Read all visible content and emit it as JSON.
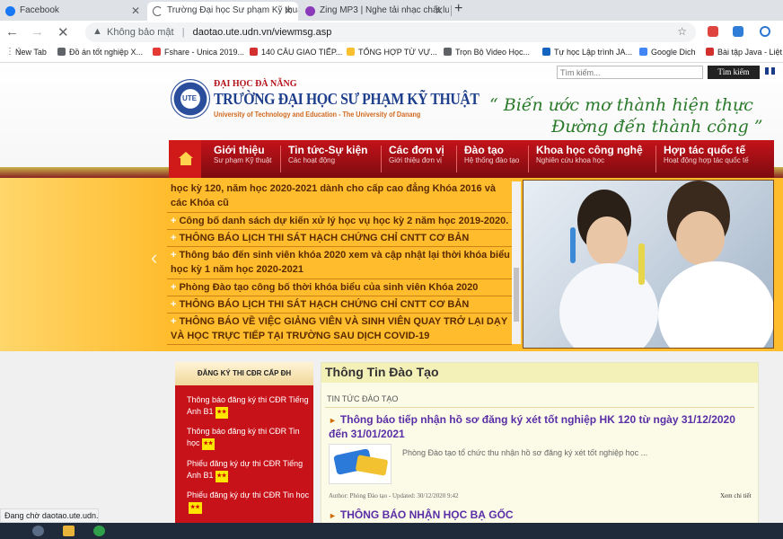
{
  "browser": {
    "tabs": [
      {
        "title": "Facebook",
        "active": false,
        "fav_color": "#1877f2"
      },
      {
        "title": "Trường Đại học Sư phạm Kỹ thuậ",
        "active": true,
        "fav_color": "#9aa0a6"
      },
      {
        "title": "Zing MP3 | Nghe tải nhạc chất lư",
        "active": false,
        "fav_color": "#8a3ab9"
      }
    ],
    "new_tab_label": "+",
    "address": {
      "security_label": "Không bảo mật",
      "url": "daotao.ute.udn.vn/viewmsg.asp"
    },
    "bookmarks": [
      {
        "label": "New Tab",
        "color": "#5f6368"
      },
      {
        "label": "Đồ án tốt nghiệp X...",
        "color": "#5f6368"
      },
      {
        "label": "Fshare - Unica 2019...",
        "color": "#e53935"
      },
      {
        "label": "140 CÂU GIAO TIẾP...",
        "color": "#d32f2f"
      },
      {
        "label": "TỔNG HỢP TỪ VỰ...",
        "color": "#fbc02d"
      },
      {
        "label": "Trọn Bộ Video Học...",
        "color": "#5f6368"
      },
      {
        "label": "Tự học Lập trình JA...",
        "color": "#1565c0"
      },
      {
        "label": "Google Dich",
        "color": "#4285f4"
      },
      {
        "label": "Bài tập Java - Liệt k",
        "color": "#d32f2f"
      }
    ],
    "status_text": "Đang chờ daotao.ute.udn.vn..."
  },
  "site": {
    "search_placeholder": "Tìm kiếm...",
    "search_button": "Tìm kiếm",
    "logo_text": "UTE",
    "parent_org": "ĐẠI HỌC ĐÀ NẴNG",
    "name": "TRƯỜNG ĐẠI HỌC SƯ PHẠM KỸ THUẬT",
    "name_en": "University of Technology and Education - The University of Danang",
    "slogan_line1": "“ Biến ước mơ thành hiện thực",
    "slogan_line2": "Đường đến thành công ”",
    "nav": [
      {
        "title": "Giới thiệu",
        "sub": "Sư phạm Kỹ thuật"
      },
      {
        "title": "Tin tức-Sự kiện",
        "sub": "Các hoạt động"
      },
      {
        "title": "Các đơn vị",
        "sub": "Giới thiệu đơn vị"
      },
      {
        "title": "Đào tạo",
        "sub": "Hệ thống đào tạo"
      },
      {
        "title": "Khoa học công nghệ",
        "sub": "Nghiên cứu khoa học"
      },
      {
        "title": "Hợp tác quốc tế",
        "sub": "Hoạt động hợp tác quốc tế"
      }
    ],
    "news_marquee": [
      "học kỳ 120, năm học 2020-2021 dành cho cấp cao đẳng Khóa 2016 và các Khóa cũ",
      "Công bố danh sách dự kiến xử lý học vụ học kỳ 2 năm học 2019-2020.",
      "THÔNG BÁO LỊCH THI SÁT HẠCH CHỨNG CHỈ CNTT CƠ BẢN",
      "Thông báo đến sinh viên khóa 2020 xem và cập nhật lại thời khóa biểu học kỳ 1 năm học 2020-2021",
      "Phòng Đào tạo công bố thời khóa biểu của sinh viên Khóa 2020",
      "THÔNG BÁO LỊCH THI SÁT HẠCH CHỨNG CHỈ CNTT CƠ BẢN",
      "THÔNG BÁO VỀ VIỆC GIẢNG VIÊN VÀ SINH VIÊN QUAY TRỞ LẠI DẠY VÀ HỌC TRỰC TIẾP TẠI TRƯỜNG SAU DỊCH COVID-19"
    ],
    "sidebar_title": "ĐĂNG KÝ THI CĐR CẤP ĐH",
    "sidebar_items": [
      "Thông báo đăng ký thi CĐR Tiếng Anh B1",
      "Thông báo đăng ký thi CĐR Tin học",
      "Phiếu đăng ký dự thi CĐR Tiếng Anh B1",
      "Phiếu đăng ký dự thi CĐR Tin học"
    ],
    "main_title": "Thông Tin Đào Tạo",
    "main_subtitle": "TIN TỨC ĐÀO TẠO",
    "articles": [
      {
        "title": "Thông báo tiếp nhận hồ sơ đăng ký xét tốt nghiệp HK 120 từ ngày 31/12/2020 đến 31/01/2021",
        "desc": "Phòng Đào tạo tổ chức thu nhận hồ sơ đăng ký xét tốt nghiệp học ...",
        "meta": "Author: Phòng Đào tạo - Updated: 30/12/2020 9:42",
        "more": "Xem chi tiết"
      },
      {
        "title": "THÔNG BÁO NHẬN HỌC BẠ GỐC"
      }
    ]
  }
}
